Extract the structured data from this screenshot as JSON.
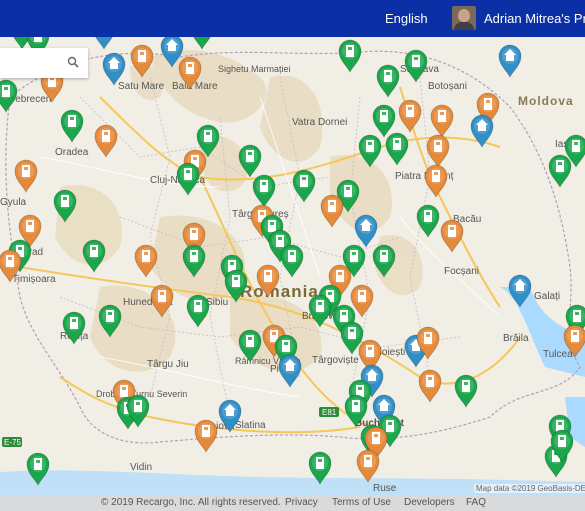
{
  "header": {
    "language": "English",
    "profile_name": "Adrian Mitrea's Profile"
  },
  "search": {
    "placeholder": ""
  },
  "map": {
    "country_label": "Romania",
    "region_labels": [
      "Moldova"
    ],
    "road_labels": [
      "E81",
      "E-75"
    ],
    "city_labels": [
      "Satu Mare",
      "Baia Mare",
      "Sighetu Marmației",
      "Suceava",
      "Botoșani",
      "Debrecen",
      "Oradea",
      "Cluj-Napoca",
      "Târgu Mureș",
      "Piatra Neamț",
      "Vatra Dornei",
      "Bacău",
      "Iași",
      "Gyula",
      "Arad",
      "Timișoara",
      "Hunedoara",
      "Sibiu",
      "Brașov",
      "Focșani",
      "Reșița",
      "Târgu Jiu",
      "Râmnicu Vâlcea",
      "Pitești",
      "Târgoviște",
      "Ploiești",
      "Brăila",
      "Galați",
      "Tulcea",
      "Drobeta-Turnu Severin",
      "Craiova",
      "Slatina",
      "Vidin",
      "Ruse",
      "Bucharest"
    ],
    "attribution": "Map data ©2019 GeoBasis-DE/BKG"
  },
  "markers": [
    {
      "color": "green",
      "icon": "charger"
    },
    {
      "color": "green",
      "icon": "charger"
    },
    {
      "color": "blue",
      "icon": "house"
    },
    {
      "color": "orange",
      "icon": "charger"
    },
    {
      "color": "blue",
      "icon": "house"
    },
    {
      "color": "orange",
      "icon": "charger"
    },
    {
      "color": "green",
      "icon": "charger"
    },
    {
      "color": "blue",
      "icon": "house"
    },
    {
      "color": "green",
      "icon": "charger"
    },
    {
      "color": "green",
      "icon": "charger"
    },
    {
      "color": "orange",
      "icon": "charger"
    },
    {
      "color": "green",
      "icon": "charger"
    },
    {
      "color": "blue",
      "icon": "house"
    },
    {
      "color": "orange",
      "icon": "charger"
    },
    {
      "color": "orange",
      "icon": "charger"
    },
    {
      "color": "green",
      "icon": "charger"
    },
    {
      "color": "green",
      "icon": "charger"
    },
    {
      "color": "orange",
      "icon": "charger"
    },
    {
      "color": "green",
      "icon": "charger"
    },
    {
      "color": "orange",
      "icon": "charger"
    },
    {
      "color": "green",
      "icon": "charger"
    },
    {
      "color": "blue",
      "icon": "house"
    },
    {
      "color": "orange",
      "icon": "charger"
    },
    {
      "color": "green",
      "icon": "charger"
    },
    {
      "color": "green",
      "icon": "charger"
    },
    {
      "color": "orange",
      "icon": "charger"
    },
    {
      "color": "green",
      "icon": "charger"
    },
    {
      "color": "green",
      "icon": "charger"
    },
    {
      "color": "green",
      "icon": "charger"
    },
    {
      "color": "orange",
      "icon": "charger"
    },
    {
      "color": "green",
      "icon": "charger"
    },
    {
      "color": "green",
      "icon": "charger"
    },
    {
      "color": "orange",
      "icon": "charger"
    },
    {
      "color": "green",
      "icon": "charger"
    },
    {
      "color": "orange",
      "icon": "charger"
    },
    {
      "color": "green",
      "icon": "charger"
    },
    {
      "color": "green",
      "icon": "charger"
    },
    {
      "color": "orange",
      "icon": "charger"
    },
    {
      "color": "green",
      "icon": "charger"
    },
    {
      "color": "orange",
      "icon": "charger"
    },
    {
      "color": "orange",
      "icon": "charger"
    },
    {
      "color": "green",
      "icon": "charger"
    },
    {
      "color": "blue",
      "icon": "house"
    },
    {
      "color": "green",
      "icon": "charger"
    },
    {
      "color": "orange",
      "icon": "charger"
    },
    {
      "color": "orange",
      "icon": "charger"
    },
    {
      "color": "green",
      "icon": "charger"
    },
    {
      "color": "green",
      "icon": "charger"
    },
    {
      "color": "orange",
      "icon": "charger"
    },
    {
      "color": "green",
      "icon": "charger"
    },
    {
      "color": "green",
      "icon": "charger"
    },
    {
      "color": "green",
      "icon": "charger"
    },
    {
      "color": "orange",
      "icon": "charger"
    },
    {
      "color": "orange",
      "icon": "charger"
    },
    {
      "color": "blue",
      "icon": "house"
    },
    {
      "color": "green",
      "icon": "charger"
    },
    {
      "color": "green",
      "icon": "charger"
    },
    {
      "color": "orange",
      "icon": "charger"
    },
    {
      "color": "green",
      "icon": "charger"
    },
    {
      "color": "green",
      "icon": "charger"
    },
    {
      "color": "green",
      "icon": "charger"
    },
    {
      "color": "orange",
      "icon": "charger"
    },
    {
      "color": "green",
      "icon": "charger"
    },
    {
      "color": "orange",
      "icon": "charger"
    },
    {
      "color": "green",
      "icon": "charger"
    },
    {
      "color": "green",
      "icon": "charger"
    },
    {
      "color": "orange",
      "icon": "charger"
    },
    {
      "color": "green",
      "icon": "charger"
    },
    {
      "color": "blue",
      "icon": "house"
    },
    {
      "color": "orange",
      "icon": "charger"
    },
    {
      "color": "green",
      "icon": "charger"
    },
    {
      "color": "blue",
      "icon": "house"
    },
    {
      "color": "orange",
      "icon": "charger"
    },
    {
      "color": "blue",
      "icon": "house"
    },
    {
      "color": "green",
      "icon": "charger"
    },
    {
      "color": "green",
      "icon": "charger"
    },
    {
      "color": "orange",
      "icon": "charger"
    },
    {
      "color": "green",
      "icon": "charger"
    },
    {
      "color": "green",
      "icon": "charger"
    },
    {
      "color": "green",
      "icon": "charger"
    },
    {
      "color": "blue",
      "icon": "house"
    },
    {
      "color": "orange",
      "icon": "charger"
    },
    {
      "color": "blue",
      "icon": "house"
    },
    {
      "color": "green",
      "icon": "charger"
    },
    {
      "color": "green",
      "icon": "charger"
    },
    {
      "color": "orange",
      "icon": "charger"
    },
    {
      "color": "green",
      "icon": "charger"
    },
    {
      "color": "green",
      "icon": "charger"
    },
    {
      "color": "green",
      "icon": "charger"
    },
    {
      "color": "orange",
      "icon": "charger"
    },
    {
      "color": "green",
      "icon": "charger"
    },
    {
      "color": "green",
      "icon": "charger"
    },
    {
      "color": "green",
      "icon": "charger"
    },
    {
      "color": "orange",
      "icon": "charger"
    },
    {
      "color": "green",
      "icon": "charger"
    },
    {
      "color": "green",
      "icon": "charger"
    }
  ],
  "marker_colors": {
    "green": "#1aa64b",
    "orange": "#e58a3a",
    "blue": "#2f8fc6"
  },
  "footer": {
    "copyright": "© 2019 Recargo, Inc. All rights reserved.",
    "privacy": "Privacy",
    "terms": "Terms of Use",
    "developers": "Developers",
    "faq": "FAQ"
  }
}
